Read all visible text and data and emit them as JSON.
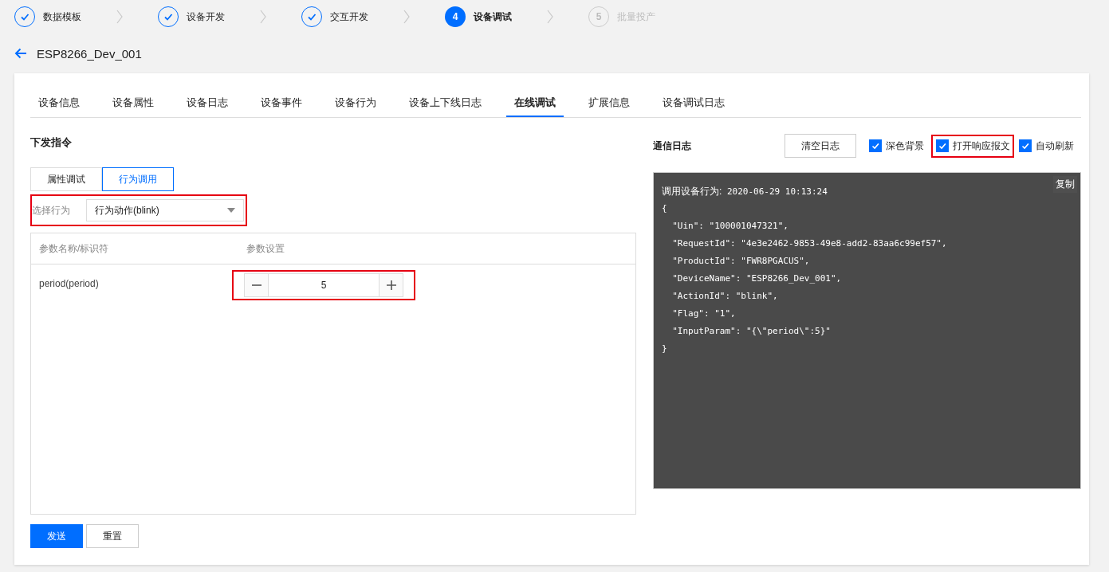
{
  "steps": [
    {
      "label": "数据模板",
      "kind": "done"
    },
    {
      "label": "设备开发",
      "kind": "done"
    },
    {
      "label": "交互开发",
      "kind": "done"
    },
    {
      "number": "4",
      "label": "设备调试",
      "kind": "current"
    },
    {
      "number": "5",
      "label": "批量投产",
      "kind": "pending"
    }
  ],
  "device_title": "ESP8266_Dev_001",
  "tabs": [
    {
      "label": "设备信息",
      "selected": false
    },
    {
      "label": "设备属性",
      "selected": false
    },
    {
      "label": "设备日志",
      "selected": false
    },
    {
      "label": "设备事件",
      "selected": false
    },
    {
      "label": "设备行为",
      "selected": false
    },
    {
      "label": "设备上下线日志",
      "selected": false
    },
    {
      "label": "在线调试",
      "selected": true
    },
    {
      "label": "扩展信息",
      "selected": false
    },
    {
      "label": "设备调试日志",
      "selected": false
    }
  ],
  "command_panel": {
    "title": "下发指令",
    "mode_tabs": [
      {
        "label": "属性调试",
        "selected": false
      },
      {
        "label": "行为调用",
        "selected": true
      }
    ],
    "action_select": {
      "label": "选择行为",
      "value": "行为动作(blink)",
      "highlighted": true
    },
    "param_table": {
      "columns": [
        "参数名称/标识符",
        "参数设置"
      ],
      "rows": [
        {
          "name": "period(period)",
          "value": "5",
          "highlighted": true
        }
      ]
    },
    "buttons": [
      {
        "label": "发送",
        "kind": "primary"
      },
      {
        "label": "重置",
        "kind": "default"
      }
    ]
  },
  "log_panel": {
    "title": "通信日志",
    "clear_button": "清空日志",
    "options": [
      {
        "label": "深色背景",
        "checked": true,
        "highlighted": false
      },
      {
        "label": "打开响应报文",
        "checked": true,
        "highlighted": true
      },
      {
        "label": "自动刷新",
        "checked": true,
        "highlighted": false
      }
    ],
    "copy_button": "复制",
    "header_label": "调用设备行为:",
    "header_time": "2020-06-29 10:13:24",
    "lines": [
      "{",
      "  \"Uin\": \"100001047321\",",
      "  \"RequestId\": \"4e3e2462-9853-49e8-add2-83aa6c99ef57\",",
      "  \"ProductId\": \"FWR8PGACUS\",",
      "  \"DeviceName\": \"ESP8266_Dev_001\",",
      "  \"ActionId\": \"blink\",",
      "  \"Flag\": \"1\",",
      "  \"InputParam\": \"{\\\"period\\\":5}\"",
      "}"
    ]
  }
}
